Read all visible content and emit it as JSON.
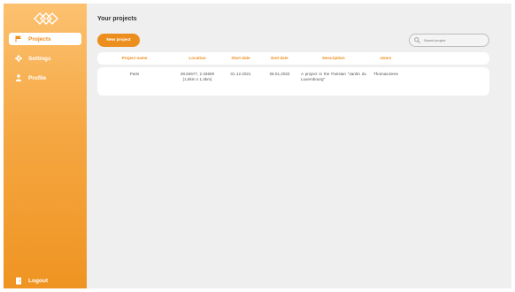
{
  "sidebar": {
    "logo_icon": "interlocked-rhombus-logo",
    "items": [
      {
        "label": "Projects",
        "icon": "flag-icon",
        "active": true
      },
      {
        "label": "Settings",
        "icon": "gear-icon",
        "active": false
      },
      {
        "label": "Profile",
        "icon": "person-icon",
        "active": false
      }
    ],
    "logout_label": "Logout",
    "logout_icon": "door-icon"
  },
  "main": {
    "title": "Your projects",
    "new_project_label": "New project",
    "search_placeholder": "Search project",
    "table": {
      "columns": [
        "Project name",
        "Location",
        "Start date",
        "End date",
        "Description",
        "Users"
      ],
      "rows": [
        {
          "name": "Paris",
          "location_line1": "48.84677, 2.33690",
          "location_line2": "(1,5km x 1,4km)",
          "start": "01.12.2021",
          "end": "28.01.2022",
          "description": "A project in the Parisian \"Jardin du Luxembourg\"",
          "users": "ThomasJoree"
        }
      ]
    }
  },
  "colors": {
    "accent": "#ec8e1e",
    "sidebar_top": "#fcc170",
    "sidebar_bottom": "#ef9422",
    "background": "#efefef"
  }
}
